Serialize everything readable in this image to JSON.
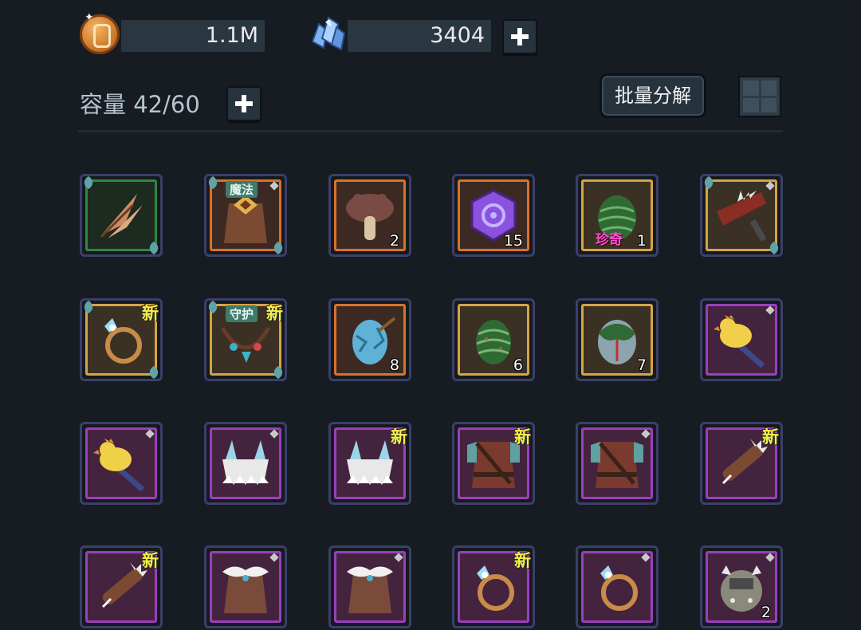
{
  "currency": {
    "gold_value": "1.1M",
    "gem_value": "3404"
  },
  "inventory": {
    "capacity_label": "容量 42/60",
    "batch_button": "批量分解",
    "slots": [
      {
        "icon": "feather-icon",
        "rarity": "green"
      },
      {
        "icon": "magic-robe-icon",
        "rarity": "orange",
        "tag": "魔法"
      },
      {
        "icon": "mushroom-icon",
        "rarity": "orange",
        "count": "2"
      },
      {
        "icon": "purple-rune-icon",
        "rarity": "orange",
        "count": "15"
      },
      {
        "icon": "green-pinecone-icon",
        "rarity": "gold",
        "rare": "珍奇",
        "count": "1"
      },
      {
        "icon": "spiked-blade-icon",
        "rarity": "gold"
      },
      {
        "icon": "ring-icon",
        "rarity": "gold",
        "new": "新"
      },
      {
        "icon": "necklace-icon",
        "rarity": "gold",
        "tag": "守护",
        "new": "新"
      },
      {
        "icon": "blue-egg-icon",
        "rarity": "orange",
        "count": "8"
      },
      {
        "icon": "green-egg-icon",
        "rarity": "gold",
        "count": "6"
      },
      {
        "icon": "dragon-egg-icon",
        "rarity": "gold",
        "count": "7"
      },
      {
        "icon": "duck-staff-icon",
        "rarity": "purple"
      },
      {
        "icon": "duck-staff-icon",
        "rarity": "purple"
      },
      {
        "icon": "fur-helmet-icon",
        "rarity": "purple"
      },
      {
        "icon": "fur-helmet-icon",
        "rarity": "purple",
        "new": "新"
      },
      {
        "icon": "leather-armor-icon",
        "rarity": "purple",
        "new": "新"
      },
      {
        "icon": "leather-armor-icon",
        "rarity": "purple"
      },
      {
        "icon": "spiked-club-icon",
        "rarity": "purple",
        "new": "新"
      },
      {
        "icon": "spiked-club-icon",
        "rarity": "purple",
        "new": "新"
      },
      {
        "icon": "fur-cloak-icon",
        "rarity": "purple"
      },
      {
        "icon": "fur-cloak-icon",
        "rarity": "purple"
      },
      {
        "icon": "ring-icon",
        "rarity": "purple",
        "new": "新"
      },
      {
        "icon": "ring-icon",
        "rarity": "purple"
      },
      {
        "icon": "spiked-helmet-icon",
        "rarity": "purple",
        "count": "2"
      }
    ]
  }
}
